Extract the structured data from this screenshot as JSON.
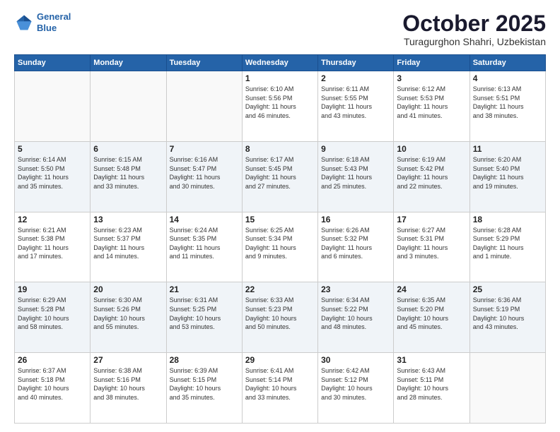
{
  "header": {
    "logo_line1": "General",
    "logo_line2": "Blue",
    "month_title": "October 2025",
    "subtitle": "Turagurghon Shahri, Uzbekistan"
  },
  "days_of_week": [
    "Sunday",
    "Monday",
    "Tuesday",
    "Wednesday",
    "Thursday",
    "Friday",
    "Saturday"
  ],
  "weeks": [
    [
      {
        "day": "",
        "info": ""
      },
      {
        "day": "",
        "info": ""
      },
      {
        "day": "",
        "info": ""
      },
      {
        "day": "1",
        "info": "Sunrise: 6:10 AM\nSunset: 5:56 PM\nDaylight: 11 hours\nand 46 minutes."
      },
      {
        "day": "2",
        "info": "Sunrise: 6:11 AM\nSunset: 5:55 PM\nDaylight: 11 hours\nand 43 minutes."
      },
      {
        "day": "3",
        "info": "Sunrise: 6:12 AM\nSunset: 5:53 PM\nDaylight: 11 hours\nand 41 minutes."
      },
      {
        "day": "4",
        "info": "Sunrise: 6:13 AM\nSunset: 5:51 PM\nDaylight: 11 hours\nand 38 minutes."
      }
    ],
    [
      {
        "day": "5",
        "info": "Sunrise: 6:14 AM\nSunset: 5:50 PM\nDaylight: 11 hours\nand 35 minutes."
      },
      {
        "day": "6",
        "info": "Sunrise: 6:15 AM\nSunset: 5:48 PM\nDaylight: 11 hours\nand 33 minutes."
      },
      {
        "day": "7",
        "info": "Sunrise: 6:16 AM\nSunset: 5:47 PM\nDaylight: 11 hours\nand 30 minutes."
      },
      {
        "day": "8",
        "info": "Sunrise: 6:17 AM\nSunset: 5:45 PM\nDaylight: 11 hours\nand 27 minutes."
      },
      {
        "day": "9",
        "info": "Sunrise: 6:18 AM\nSunset: 5:43 PM\nDaylight: 11 hours\nand 25 minutes."
      },
      {
        "day": "10",
        "info": "Sunrise: 6:19 AM\nSunset: 5:42 PM\nDaylight: 11 hours\nand 22 minutes."
      },
      {
        "day": "11",
        "info": "Sunrise: 6:20 AM\nSunset: 5:40 PM\nDaylight: 11 hours\nand 19 minutes."
      }
    ],
    [
      {
        "day": "12",
        "info": "Sunrise: 6:21 AM\nSunset: 5:38 PM\nDaylight: 11 hours\nand 17 minutes."
      },
      {
        "day": "13",
        "info": "Sunrise: 6:23 AM\nSunset: 5:37 PM\nDaylight: 11 hours\nand 14 minutes."
      },
      {
        "day": "14",
        "info": "Sunrise: 6:24 AM\nSunset: 5:35 PM\nDaylight: 11 hours\nand 11 minutes."
      },
      {
        "day": "15",
        "info": "Sunrise: 6:25 AM\nSunset: 5:34 PM\nDaylight: 11 hours\nand 9 minutes."
      },
      {
        "day": "16",
        "info": "Sunrise: 6:26 AM\nSunset: 5:32 PM\nDaylight: 11 hours\nand 6 minutes."
      },
      {
        "day": "17",
        "info": "Sunrise: 6:27 AM\nSunset: 5:31 PM\nDaylight: 11 hours\nand 3 minutes."
      },
      {
        "day": "18",
        "info": "Sunrise: 6:28 AM\nSunset: 5:29 PM\nDaylight: 11 hours\nand 1 minute."
      }
    ],
    [
      {
        "day": "19",
        "info": "Sunrise: 6:29 AM\nSunset: 5:28 PM\nDaylight: 10 hours\nand 58 minutes."
      },
      {
        "day": "20",
        "info": "Sunrise: 6:30 AM\nSunset: 5:26 PM\nDaylight: 10 hours\nand 55 minutes."
      },
      {
        "day": "21",
        "info": "Sunrise: 6:31 AM\nSunset: 5:25 PM\nDaylight: 10 hours\nand 53 minutes."
      },
      {
        "day": "22",
        "info": "Sunrise: 6:33 AM\nSunset: 5:23 PM\nDaylight: 10 hours\nand 50 minutes."
      },
      {
        "day": "23",
        "info": "Sunrise: 6:34 AM\nSunset: 5:22 PM\nDaylight: 10 hours\nand 48 minutes."
      },
      {
        "day": "24",
        "info": "Sunrise: 6:35 AM\nSunset: 5:20 PM\nDaylight: 10 hours\nand 45 minutes."
      },
      {
        "day": "25",
        "info": "Sunrise: 6:36 AM\nSunset: 5:19 PM\nDaylight: 10 hours\nand 43 minutes."
      }
    ],
    [
      {
        "day": "26",
        "info": "Sunrise: 6:37 AM\nSunset: 5:18 PM\nDaylight: 10 hours\nand 40 minutes."
      },
      {
        "day": "27",
        "info": "Sunrise: 6:38 AM\nSunset: 5:16 PM\nDaylight: 10 hours\nand 38 minutes."
      },
      {
        "day": "28",
        "info": "Sunrise: 6:39 AM\nSunset: 5:15 PM\nDaylight: 10 hours\nand 35 minutes."
      },
      {
        "day": "29",
        "info": "Sunrise: 6:41 AM\nSunset: 5:14 PM\nDaylight: 10 hours\nand 33 minutes."
      },
      {
        "day": "30",
        "info": "Sunrise: 6:42 AM\nSunset: 5:12 PM\nDaylight: 10 hours\nand 30 minutes."
      },
      {
        "day": "31",
        "info": "Sunrise: 6:43 AM\nSunset: 5:11 PM\nDaylight: 10 hours\nand 28 minutes."
      },
      {
        "day": "",
        "info": ""
      }
    ]
  ]
}
